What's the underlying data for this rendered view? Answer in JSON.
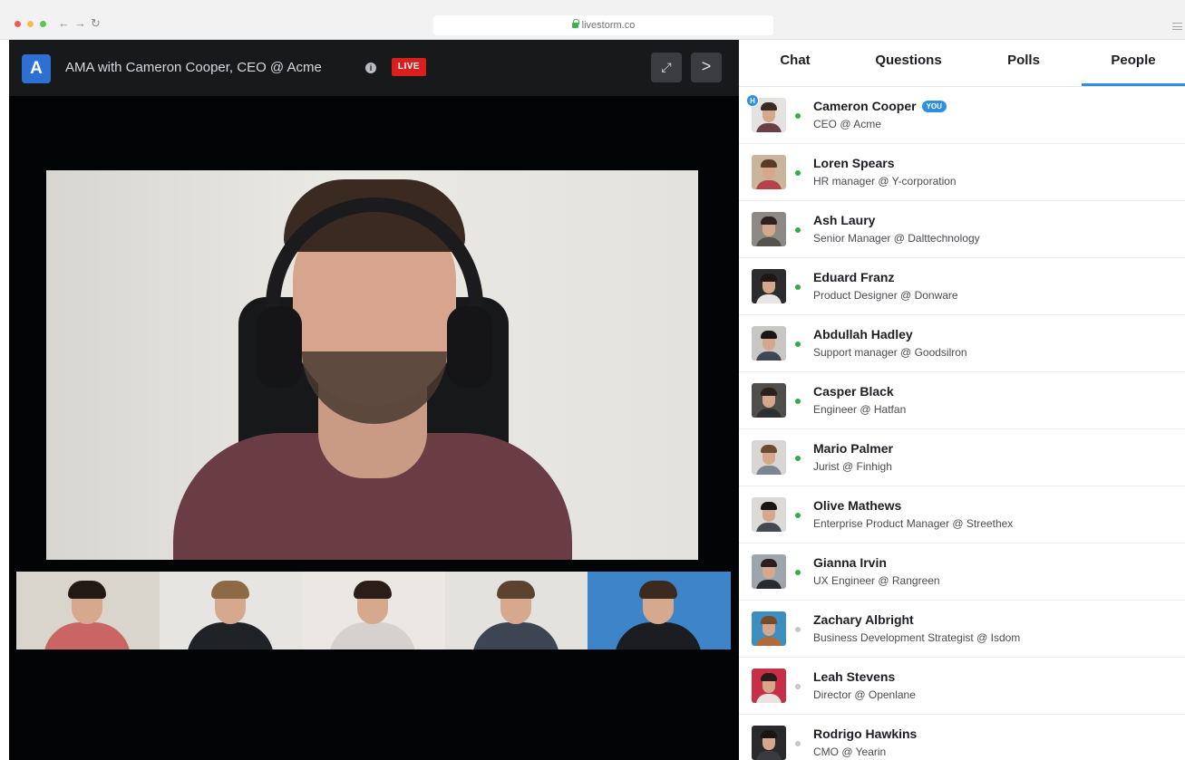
{
  "browser": {
    "url": "livestorm.co",
    "traffic_lights": [
      "#ee5c55",
      "#f5bd4f",
      "#61c554"
    ],
    "nav_back_glyph": "←",
    "nav_forward_glyph": "→",
    "nav_reload_glyph": "↻"
  },
  "event": {
    "logo_letter": "A",
    "title": "AMA with Cameron Cooper, CEO @ Acme",
    "info_glyph": "i",
    "live_label": "LIVE",
    "fullscreen_glyph": "⤢",
    "next_glyph": ">"
  },
  "thumbnails": [
    {
      "bg": "#d9d4cc",
      "hair": "#231a16",
      "shirt": "#c96565"
    },
    {
      "bg": "#e7e5e1",
      "hair": "#8d6a45",
      "shirt": "#1f2226"
    },
    {
      "bg": "#ebe8e3",
      "hair": "#2b1d17",
      "shirt": "#d4d1cf"
    },
    {
      "bg": "#e3e2df",
      "hair": "#5b432f",
      "shirt": "#3e4552"
    },
    {
      "bg": "#3e84c9",
      "hair": "#3c2a20",
      "shirt": "#1c1d21"
    }
  ],
  "tabs": [
    {
      "label": "Chat",
      "active": false
    },
    {
      "label": "Questions",
      "active": false
    },
    {
      "label": "Polls",
      "active": false
    },
    {
      "label": "People",
      "active": true
    }
  ],
  "colors": {
    "online": "#2fae47",
    "offline": "#c6c6ca",
    "accent": "#2f8fe0",
    "live": "#d9201f"
  },
  "people": [
    {
      "name": "Cameron Cooper",
      "role": "CEO @ Acme",
      "online": true,
      "you_label": "YOU",
      "host_label": "H",
      "avatar": {
        "bg": "#e2e2e0",
        "hair": "#3b2a22",
        "shirt": "#6c3f47"
      }
    },
    {
      "name": "Loren Spears",
      "role": "HR manager @ Y-corporation",
      "online": true,
      "avatar": {
        "bg": "#c9b59c",
        "hair": "#5a3b28",
        "shirt": "#b5424a"
      }
    },
    {
      "name": "Ash Laury",
      "role": "Senior Manager @ Dalttechnology",
      "online": true,
      "avatar": {
        "bg": "#8d8a86",
        "hair": "#2d221d",
        "shirt": "#55524f"
      }
    },
    {
      "name": "Eduard Franz",
      "role": "Product Designer @ Donware",
      "online": true,
      "avatar": {
        "bg": "#2c2c2f",
        "hair": "#1e1714",
        "shirt": "#e9e6e2"
      }
    },
    {
      "name": "Abdullah Hadley",
      "role": "Support manager @ Goodsilron",
      "online": true,
      "avatar": {
        "bg": "#c8c7c4",
        "hair": "#1c1614",
        "shirt": "#3f4756"
      }
    },
    {
      "name": "Casper Black",
      "role": "Engineer @ Hatfan",
      "online": true,
      "avatar": {
        "bg": "#4f4e4b",
        "hair": "#2b2118",
        "shirt": "#2f3034"
      }
    },
    {
      "name": "Mario Palmer",
      "role": "Jurist @ Finhigh",
      "online": true,
      "avatar": {
        "bg": "#d8d6d2",
        "hair": "#6a4b33",
        "shirt": "#7c8592"
      }
    },
    {
      "name": "Olive Mathews",
      "role": "Enterprise Product Manager @ Streethex",
      "online": true,
      "avatar": {
        "bg": "#dcdad6",
        "hair": "#1a1412",
        "shirt": "#454a52"
      }
    },
    {
      "name": "Gianna Irvin",
      "role": "UX Engineer @ Rangreen",
      "online": true,
      "avatar": {
        "bg": "#9da5ad",
        "hair": "#2a201b",
        "shirt": "#2a2b2f"
      }
    },
    {
      "name": "Zachary Albright",
      "role": "Business Development Strategist @ Isdom",
      "online": false,
      "avatar": {
        "bg": "#3b8fc0",
        "hair": "#7a4a2c",
        "shirt": "#b36a3a"
      }
    },
    {
      "name": "Leah Stevens",
      "role": "Director @ Openlane",
      "online": false,
      "avatar": {
        "bg": "#c72f48",
        "hair": "#2a1c18",
        "shirt": "#e8e3de"
      }
    },
    {
      "name": "Rodrigo Hawkins",
      "role": "CMO @ Yearin",
      "online": false,
      "avatar": {
        "bg": "#2a2a2d",
        "hair": "#1a1513",
        "shirt": "#3a3b40"
      }
    }
  ]
}
